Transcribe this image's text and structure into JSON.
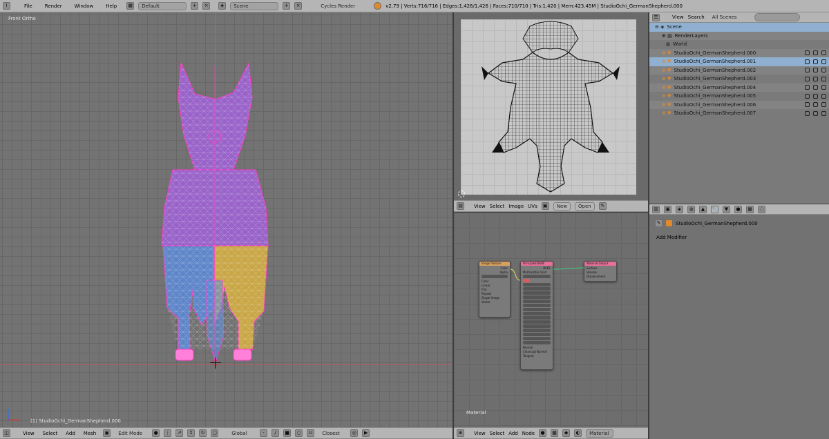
{
  "topbar": {
    "menus": [
      "File",
      "Render",
      "Window",
      "Help"
    ],
    "screen_layout": "Default",
    "scene": "Scene",
    "render_engine": "Cycles Render",
    "stats": "v2.79 | Verts:716/716 | Edges:1,426/1,426 | Faces:710/710 | Tris:1,420 | Mem:423.45M | StudioOchi_GermanShepherd.000"
  },
  "viewport": {
    "view_label": "Front Ortho",
    "object_label": "(1) StudioOchi_GermanShepherd.000",
    "menu": [
      "View",
      "Select",
      "Add",
      "Mesh"
    ],
    "mode": "Edit Mode",
    "orientation": "Global",
    "snap": "Closest"
  },
  "uv_editor": {
    "menu": [
      "View",
      "Select",
      "Image",
      "UVs"
    ],
    "new_label": "New",
    "open_label": "Open"
  },
  "node_editor": {
    "material_label": "Material",
    "menu": [
      "View",
      "Select",
      "Add",
      "Node"
    ],
    "material_field": "Material",
    "nodes": {
      "image": {
        "title": "Image Texture",
        "outputs": [
          "Color",
          "Alpha"
        ],
        "options": [
          "Color",
          "Linear",
          "Flat",
          "Repeat",
          "Single Image"
        ],
        "input": "Vector"
      },
      "bsdf": {
        "title": "Principled BSDF",
        "output": "BSDF",
        "rows": [
          "Multiscatter GGX",
          "Christensen-Burley",
          "Base Color",
          "Subsurface",
          "Subsurface Radius",
          "Subsurface Color",
          "Metallic",
          "Specular",
          "Specular Tint",
          "Roughness",
          "Anisotropic",
          "Anisotropic Rotation",
          "Sheen",
          "Sheen Tint",
          "Clearcoat",
          "Clearcoat Roughness",
          "IOR",
          "Transmission",
          "Normal",
          "Clearcoat Normal",
          "Tangent"
        ]
      },
      "output": {
        "title": "Material Output",
        "inputs": [
          "Surface",
          "Volume",
          "Displacement"
        ]
      }
    }
  },
  "outliner": {
    "menu": [
      "View",
      "Search"
    ],
    "filter": "All Scenes",
    "items": [
      {
        "label": "Scene",
        "level": 0
      },
      {
        "label": "RenderLayers",
        "level": 1
      },
      {
        "label": "World",
        "level": 1
      },
      {
        "label": "StudioOchi_GermanShepherd.000",
        "level": 1
      },
      {
        "label": "StudioOchi_GermanShepherd.001",
        "level": 1
      },
      {
        "label": "StudioOchi_GermanShepherd.002",
        "level": 1
      },
      {
        "label": "StudioOchi_GermanShepherd.003",
        "level": 1
      },
      {
        "label": "StudioOchi_GermanShepherd.004",
        "level": 1
      },
      {
        "label": "StudioOchi_GermanShepherd.005",
        "level": 1
      },
      {
        "label": "StudioOchi_GermanShepherd.006",
        "level": 1
      },
      {
        "label": "StudioOchi_GermanShepherd.007",
        "level": 1
      }
    ]
  },
  "properties": {
    "object_name": "StudioOchi_GermanShepherd.000",
    "add_modifier": "Add Modifier"
  },
  "colors": {
    "selection": "#8fb0d0",
    "vertex_pink": "#ff3cc8",
    "mesh_purple": "#a060d8",
    "mesh_blue": "#5a8ad8",
    "mesh_yellow": "#d8b040"
  }
}
